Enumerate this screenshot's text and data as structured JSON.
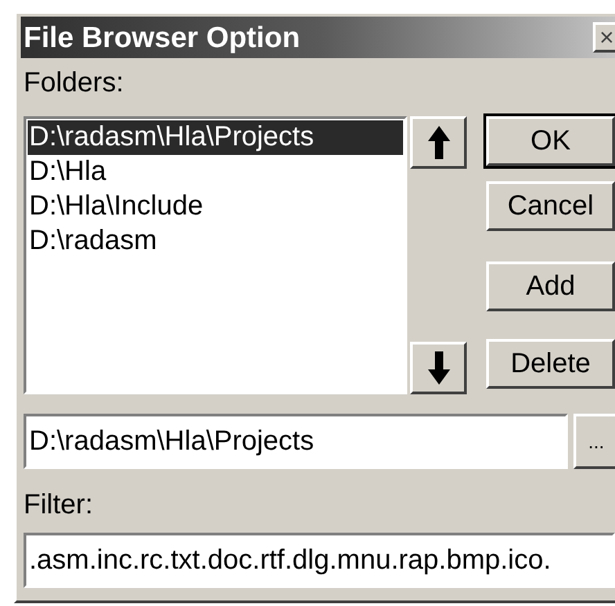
{
  "window": {
    "title": "File Browser Option",
    "close": "×"
  },
  "folders_label": "Folders:",
  "folders": [
    {
      "path": "D:\\radasm\\Hla\\Projects",
      "selected": true
    },
    {
      "path": "D:\\Hla",
      "selected": false
    },
    {
      "path": "D:\\Hla\\Include",
      "selected": false
    },
    {
      "path": "D:\\radasm",
      "selected": false
    }
  ],
  "buttons": [
    {
      "label": "OK",
      "default": true
    },
    {
      "label": "Cancel",
      "default": false
    },
    {
      "label": "Add",
      "default": false
    },
    {
      "label": "Delete",
      "default": false
    }
  ],
  "path_field": {
    "value": "D:\\radasm\\Hla\\Projects"
  },
  "browse_button": "...",
  "filter_label": "Filter:",
  "filter_field": {
    "value": ".asm.inc.rc.txt.doc.rtf.dlg.mnu.rap.bmp.ico."
  }
}
